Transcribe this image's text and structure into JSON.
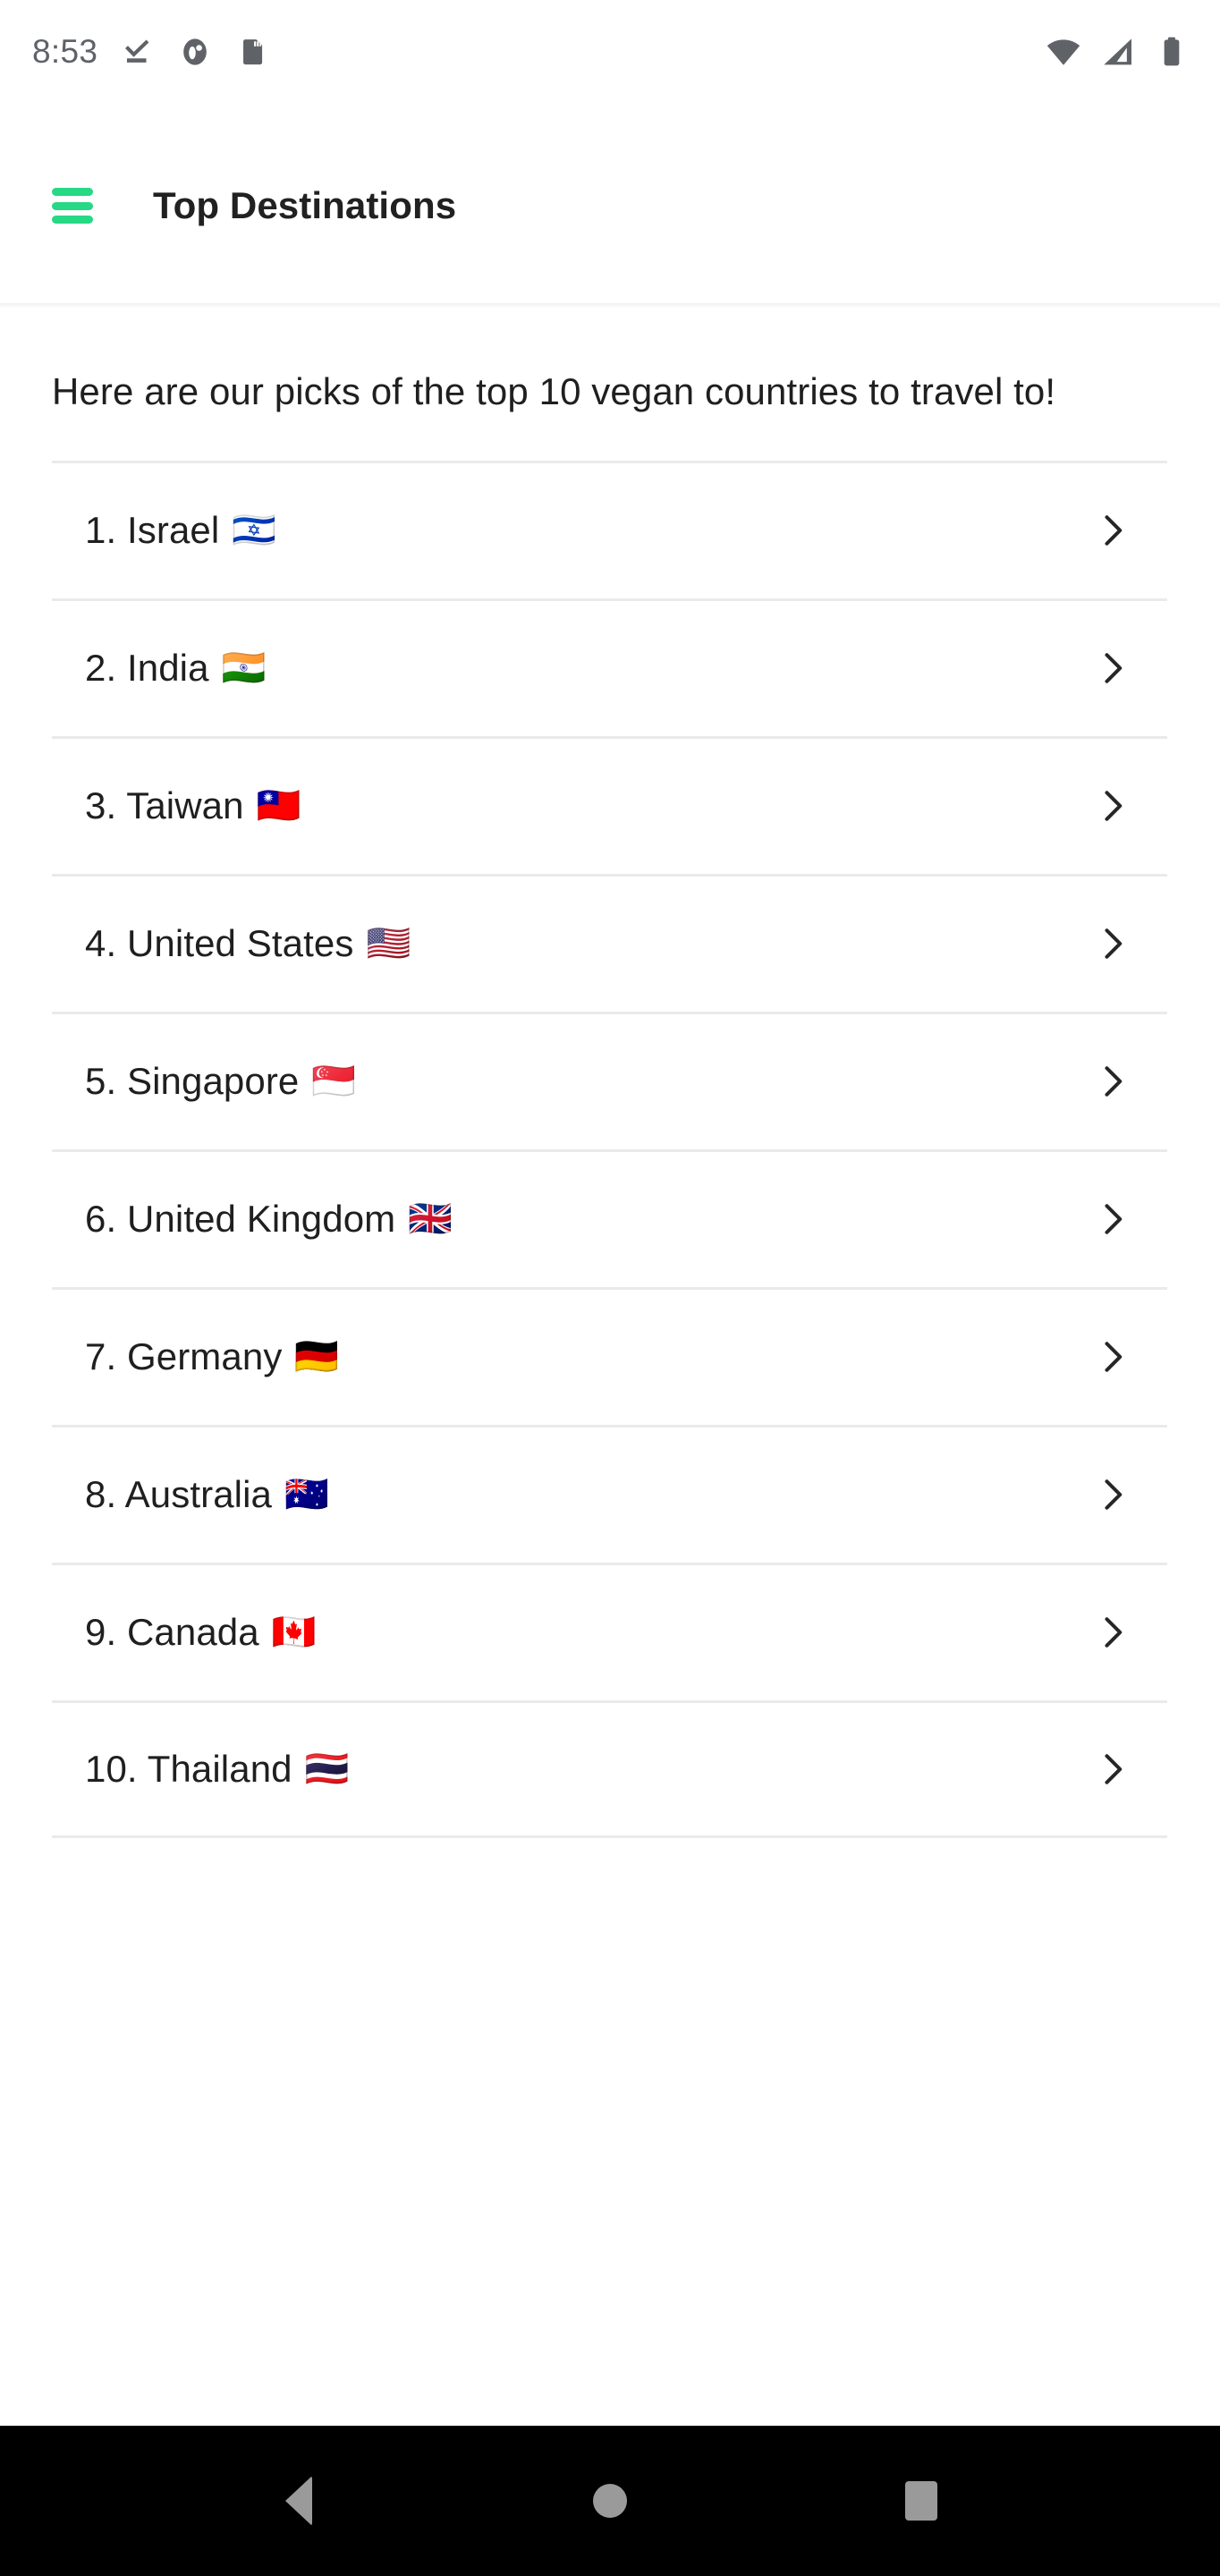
{
  "status_bar": {
    "time": "8:53",
    "left_icons": [
      "download-complete-icon",
      "app-notification-icon",
      "sd-card-icon"
    ],
    "right_icons": [
      "wifi-icon",
      "cellular-signal-icon",
      "battery-icon"
    ],
    "icon_color": "#5f6368"
  },
  "app_bar": {
    "menu_icon": "hamburger-menu-icon",
    "menu_color": "#27d884",
    "title": "Top Destinations"
  },
  "content": {
    "intro_text": "Here are our picks of the top 10 vegan countries to travel to!",
    "chevron_icon": "chevron-right-icon",
    "destinations": [
      {
        "rank": "1.",
        "name": "Israel",
        "flag": "🇮🇱",
        "label": "1. Israel"
      },
      {
        "rank": "2.",
        "name": "India",
        "flag": "🇮🇳",
        "label": "2. India"
      },
      {
        "rank": "3.",
        "name": "Taiwan",
        "flag": "🇹🇼",
        "label": "3. Taiwan"
      },
      {
        "rank": "4.",
        "name": "United States",
        "flag": "🇺🇸",
        "label": "4. United States"
      },
      {
        "rank": "5.",
        "name": "Singapore",
        "flag": "🇸🇬",
        "label": "5. Singapore"
      },
      {
        "rank": "6.",
        "name": "United Kingdom",
        "flag": "🇬🇧",
        "label": "6. United Kingdom"
      },
      {
        "rank": "7.",
        "name": "Germany",
        "flag": "🇩🇪",
        "label": "7. Germany"
      },
      {
        "rank": "8.",
        "name": "Australia",
        "flag": "🇦🇺",
        "label": "8. Australia"
      },
      {
        "rank": "9.",
        "name": "Canada",
        "flag": "🇨🇦",
        "label": "9. Canada"
      },
      {
        "rank": "10.",
        "name": "Thailand",
        "flag": "🇹🇭",
        "label": "10. Thailand"
      }
    ]
  },
  "nav_bar": {
    "back_label": "Back",
    "home_label": "Home",
    "recents_label": "Recent apps",
    "icon_color": "#9a9a9a",
    "background": "#000000"
  }
}
